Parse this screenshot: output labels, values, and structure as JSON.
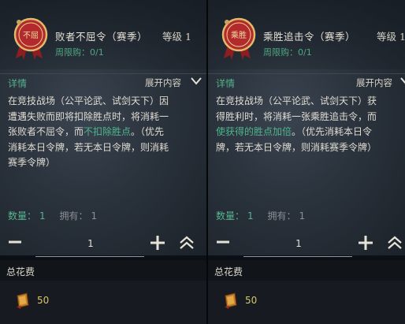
{
  "panels": [
    {
      "item_name": "败者不屈令（赛季）",
      "level": "等级 1",
      "limit": "周限购：0/1",
      "detail_label": "详情",
      "expand_label": "展开内容",
      "desc": [
        [
          {
            "t": "在竞技战场（公平论武、试剑天下）因",
            "g": false
          }
        ],
        [
          {
            "t": "遭遇失败而即将扣除胜点时，将消耗一",
            "g": false
          }
        ],
        [
          {
            "t": "张败者不屈令，而",
            "g": false
          },
          {
            "t": "不扣除胜点",
            "g": true
          },
          {
            "t": "。（优先",
            "g": false
          }
        ],
        [
          {
            "t": "消耗本日令牌，若无本日令牌，则消耗",
            "g": false
          }
        ],
        [
          {
            "t": "赛季令牌）",
            "g": false
          }
        ]
      ],
      "qty_label": "数量：",
      "qty_value": "1",
      "owned_label": "拥有：",
      "owned_value": "1",
      "stepper_value": "1",
      "total_label": "总花费",
      "price": "50",
      "icon_char": "不屈",
      "seal_text": "不屈"
    },
    {
      "item_name": "乘胜追击令（赛季）",
      "level": "等级 1",
      "limit": "周限购：0/1",
      "detail_label": "详情",
      "expand_label": "展开内容",
      "desc": [
        [
          {
            "t": "在竞技战场（公平论武、试剑天下）获",
            "g": false
          }
        ],
        [
          {
            "t": "得胜利时，将消耗一张乘胜追击令，而",
            "g": false
          }
        ],
        [
          {
            "t": "使获得的胜点加倍",
            "g": true
          },
          {
            "t": "。（优先消耗本日令",
            "g": false
          }
        ],
        [
          {
            "t": "牌，若无本日令牌，则消耗赛季令牌）",
            "g": false
          }
        ]
      ],
      "qty_label": "数量：",
      "qty_value": "1",
      "owned_label": "拥有：",
      "owned_value": "1",
      "stepper_value": "1",
      "total_label": "总花费",
      "price": "50",
      "seal_text": "乘胜"
    }
  ],
  "colors": {
    "accent_green": "#4fb68e",
    "price_gold": "#d9c46a",
    "seal_red": "#b0242a"
  },
  "icons": [
    "seal-token-icon",
    "chevron-down-icon",
    "minus-icon",
    "plus-icon",
    "max-chevrons-icon",
    "currency-coin-icon"
  ]
}
